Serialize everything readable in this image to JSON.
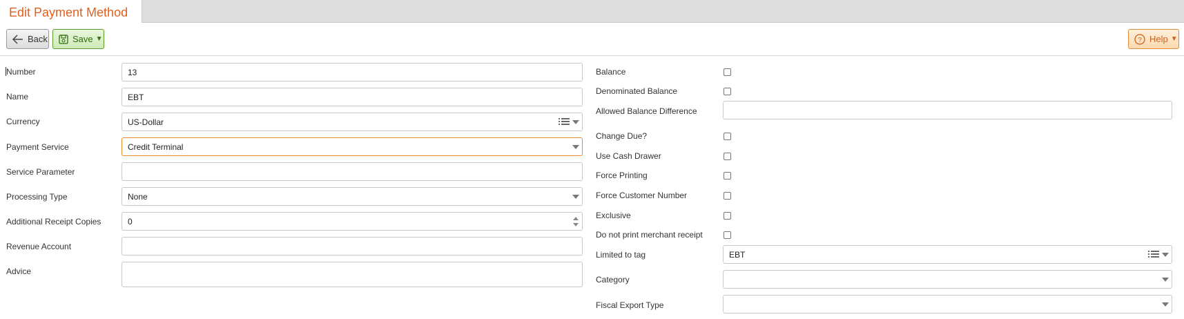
{
  "tab": {
    "title": "Edit Payment Method"
  },
  "toolbar": {
    "back_label": "Back",
    "save_label": "Save",
    "help_label": "Help"
  },
  "left_fields": [
    {
      "label": "Number",
      "value": "13",
      "kind": "text"
    },
    {
      "label": "Name",
      "value": "EBT",
      "kind": "text"
    },
    {
      "label": "Currency",
      "value": "US-Dollar",
      "kind": "list-select"
    },
    {
      "label": "Payment Service",
      "value": "Credit Terminal",
      "kind": "select"
    },
    {
      "label": "Service Parameter",
      "value": "",
      "kind": "text"
    },
    {
      "label": "Processing Type",
      "value": "None",
      "kind": "select"
    },
    {
      "label": "Additional Receipt Copies",
      "value": "0",
      "kind": "number"
    },
    {
      "label": "Revenue Account",
      "value": "",
      "kind": "text"
    },
    {
      "label": "Advice",
      "value": "",
      "kind": "textarea"
    }
  ],
  "right_fields": {
    "balance": {
      "label": "Balance",
      "checked": false
    },
    "denominated_balance": {
      "label": "Denominated Balance",
      "checked": false
    },
    "allowed_balance_difference": {
      "label": "Allowed Balance Difference",
      "value": ""
    },
    "change_due": {
      "label": "Change Due?",
      "checked": false
    },
    "use_cash_drawer": {
      "label": "Use Cash Drawer",
      "checked": false
    },
    "force_printing": {
      "label": "Force Printing",
      "checked": false
    },
    "force_customer_number": {
      "label": "Force Customer Number",
      "checked": false
    },
    "exclusive": {
      "label": "Exclusive",
      "checked": false
    },
    "no_merchant_receipt": {
      "label": "Do not print merchant receipt",
      "checked": false
    },
    "limited_to_tag": {
      "label": "Limited to tag",
      "value": "EBT"
    },
    "category": {
      "label": "Category",
      "value": ""
    },
    "fiscal_export_type": {
      "label": "Fiscal Export Type",
      "value": ""
    }
  },
  "colors": {
    "accent": "#e0601f",
    "save_green": "#2f6b11",
    "help_orange": "#c8621a",
    "focus_border": "#e8892d"
  },
  "icons": {
    "back": "arrow-left-icon",
    "save": "floppy-disk-icon",
    "help": "question-circle-icon"
  }
}
